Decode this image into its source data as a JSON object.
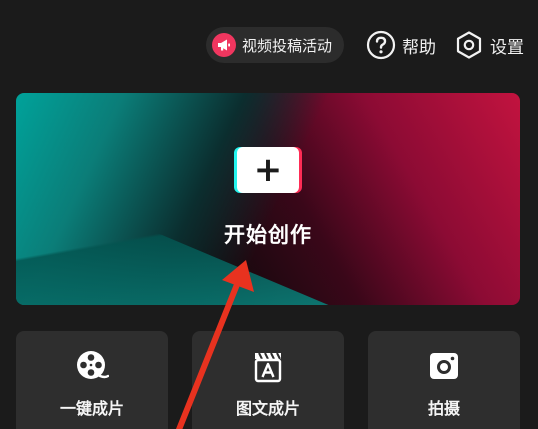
{
  "top_bar": {
    "promo_label": "视频投稿活动",
    "help_label": "帮助",
    "settings_label": "设置"
  },
  "banner": {
    "title": "开始创作",
    "plus_symbol": "+"
  },
  "actions": [
    {
      "label": "一键成片",
      "icon": "film-reel-icon"
    },
    {
      "label": "图文成片",
      "icon": "text-clapper-icon"
    },
    {
      "label": "拍摄",
      "icon": "camera-icon"
    }
  ],
  "colors": {
    "background": "#1b1b1b",
    "card": "#2e2e2e",
    "promo_accent": "#f0365f",
    "teal": "#00a29a",
    "crimson": "#c2133f",
    "annotation": "#e8321f"
  }
}
